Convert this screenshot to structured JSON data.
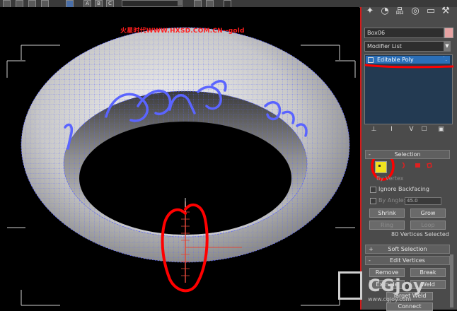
{
  "viewport": {
    "site_title": "火星时代WWW.HXSD.COM.CN--gold"
  },
  "toolbar": {
    "letter_buttons": [
      "A",
      "B",
      "C"
    ],
    "dropdown_value": ""
  },
  "command_panel": {
    "tabs": [
      {
        "name": "create",
        "glyph": "✦"
      },
      {
        "name": "modify",
        "glyph": "◔"
      },
      {
        "name": "hierarchy",
        "glyph": "品"
      },
      {
        "name": "motion",
        "glyph": "◎"
      },
      {
        "name": "display",
        "glyph": "▭"
      },
      {
        "name": "utilities",
        "glyph": "⚒"
      }
    ],
    "object_name": "Box06",
    "object_color": "#e6a3a3",
    "modifier_list_label": "Modifier List",
    "modifier_stack": [
      {
        "label": "Editable Poly",
        "selected": true
      }
    ],
    "stack_tools": [
      "⊥",
      "I",
      "V",
      "☐",
      "▣"
    ],
    "selection_rollout": {
      "title": "Selection",
      "toggle": "-",
      "sub_object_levels": [
        "vertex",
        "edge",
        "border",
        "polygon",
        "element"
      ],
      "active_level": "vertex",
      "by_vertex_label": "By Vertex",
      "ignore_backfacing_label": "Ignore Backfacing",
      "by_angle_label": "By Angle:",
      "by_angle_value": "45.0",
      "shrink_label": "Shrink",
      "grow_label": "Grow",
      "ring_label": "Ring",
      "loop_label": "Loop",
      "status": "80 Vertices Selected"
    },
    "soft_selection_rollout": {
      "title": "Soft Selection",
      "toggle": "+"
    },
    "edit_vertices_rollout": {
      "title": "Edit Vertices",
      "toggle": "-",
      "remove_label": "Remove",
      "break_label": "Break",
      "extrude_label": "Extrude",
      "weld_label": "Weld",
      "target_weld_label": "Target Weld",
      "connect_label": "Connect"
    }
  },
  "watermark": {
    "text": "CGjoy",
    "url": "www.cgjoy.com"
  },
  "colors": {
    "annotation_red": "#ff0000",
    "wire_blue": "#5a64ff",
    "selection_orange": "#e0473a",
    "accent_blue": "#2b6fb8",
    "vertex_yellow": "#f1e21e"
  }
}
